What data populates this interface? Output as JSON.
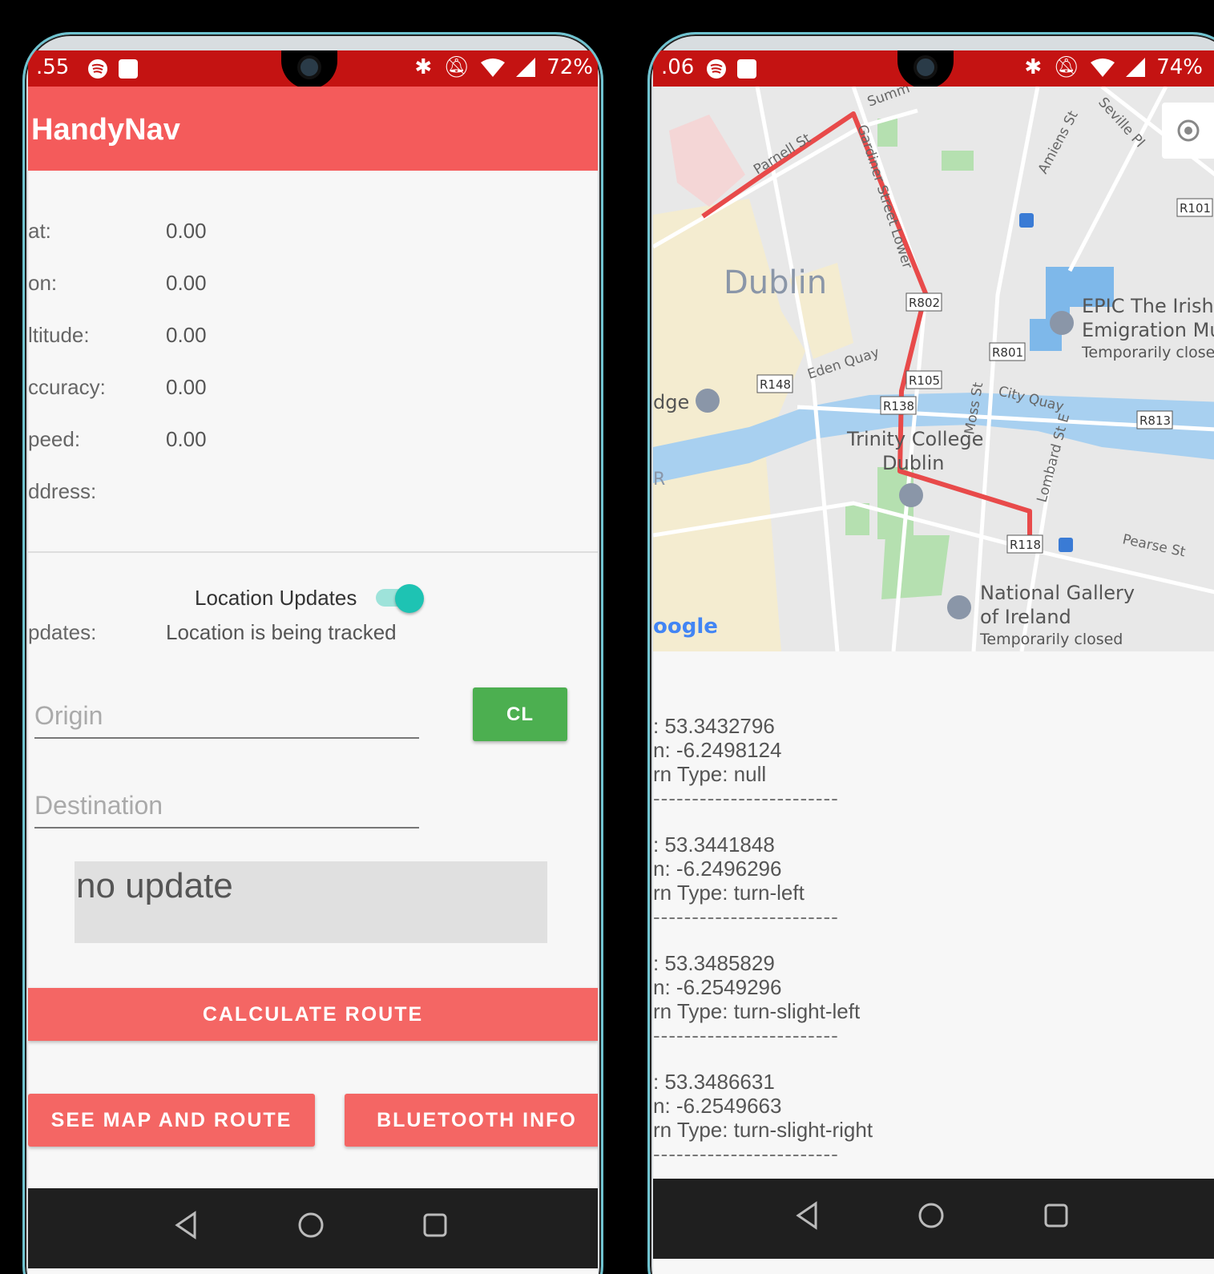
{
  "left_phone": {
    "status": {
      "time": ".55",
      "battery": "72%"
    },
    "app_title": "HandyNav",
    "info": [
      {
        "label": "at:",
        "value": "0.00"
      },
      {
        "label": "on:",
        "value": "0.00"
      },
      {
        "label": "ltitude:",
        "value": "0.00"
      },
      {
        "label": "ccuracy:",
        "value": "0.00"
      },
      {
        "label": "peed:",
        "value": "0.00"
      },
      {
        "label": "ddress:",
        "value": ""
      }
    ],
    "toggle_label": "Location Updates",
    "toggle_on": true,
    "updates_label": "pdates:",
    "updates_value": "Location is being tracked",
    "origin_placeholder": "Origin",
    "cl_button": "CL",
    "destination_placeholder": "Destination",
    "nav_text": "no update",
    "calc_button": "CALCULATE ROUTE",
    "map_button": "SEE MAP AND ROUTE",
    "bt_button": "BLUETOOTH INFO"
  },
  "right_phone": {
    "status": {
      "time": ".06",
      "battery": "74%"
    },
    "map": {
      "city": "Dublin",
      "streets": [
        "Summ",
        "Parnell St",
        "Gardiner Street Lower",
        "Amiens St",
        "Seville Pl",
        "Eden Quay",
        "City Quay",
        "Moss St",
        "Lombard St E",
        "Pearse St"
      ],
      "roads": [
        "R802",
        "R801",
        "R148",
        "R105",
        "R138",
        "R813",
        "R118",
        "R101"
      ],
      "places": [
        {
          "name": "EPIC The Irish",
          "name2": "Emigration Mu",
          "note": "Temporarily close"
        },
        {
          "name": "Trinity College",
          "name2": "Dublin",
          "note": ""
        },
        {
          "name": "National Gallery",
          "name2": "of Ireland",
          "note": "Temporarily closed"
        }
      ],
      "left_edge": "dge",
      "left_r": "R",
      "logo": "oogle"
    },
    "steps": [
      {
        "lat": ": 53.3432796",
        "lng": "n: -6.2498124",
        "type": "rn Type: null"
      },
      {
        "lat": ": 53.3441848",
        "lng": "n: -6.2496296",
        "type": "rn Type: turn-left"
      },
      {
        "lat": ": 53.3485829",
        "lng": "n: -6.2549296",
        "type": "rn Type: turn-slight-left"
      },
      {
        "lat": ": 53.3486631",
        "lng": "n: -6.2549663",
        "type": "rn Type: turn-slight-right"
      }
    ],
    "separator": "------------------------"
  },
  "colors": {
    "accent": "#f45b5b",
    "status": "#c41312",
    "green": "#4caf50",
    "teal": "#1ec3b3"
  }
}
